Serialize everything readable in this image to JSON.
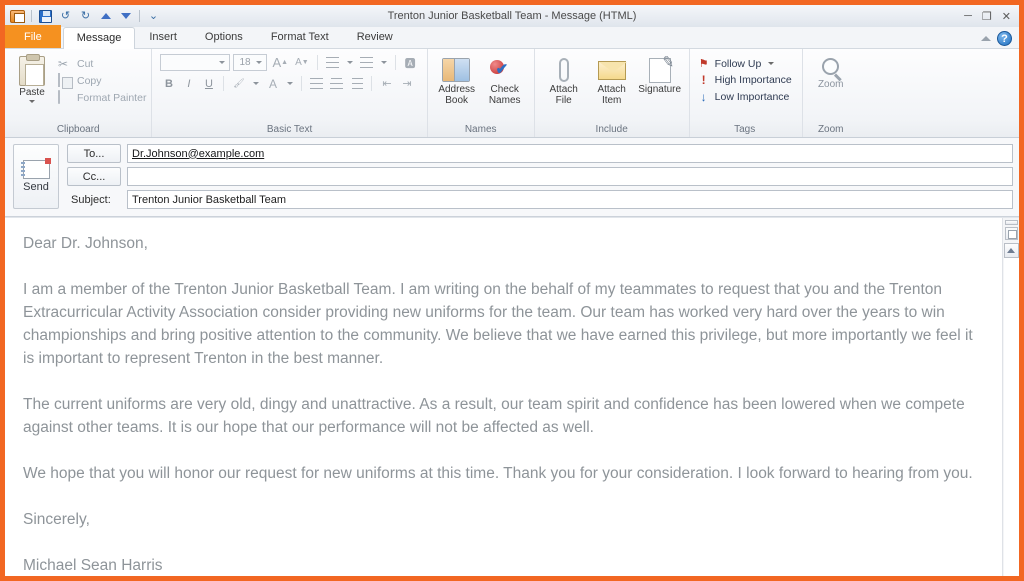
{
  "window": {
    "title": "Trenton Junior Basketball Team  -  Message (HTML)",
    "minimize": "─",
    "restore": "❐",
    "close": "✕",
    "accent_color": "#f26722",
    "file_tab_color": "#f59120"
  },
  "quick_access": {
    "items": [
      {
        "name": "outlook-icon",
        "label": "Outlook"
      },
      {
        "name": "save-icon",
        "label": "Save"
      },
      {
        "name": "undo-icon",
        "label": "Undo"
      },
      {
        "name": "redo-icon",
        "label": "Redo"
      },
      {
        "name": "previous-item-icon",
        "label": "Previous Item"
      },
      {
        "name": "next-item-icon",
        "label": "Next Item"
      },
      {
        "name": "customize-icon",
        "label": "Customize Quick Access Toolbar"
      }
    ],
    "undo_glyph": "↺",
    "redo_glyph": "↻",
    "customize_glyph": "⌄"
  },
  "tabs": [
    {
      "label": "File",
      "active": false
    },
    {
      "label": "Message",
      "active": true
    },
    {
      "label": "Insert",
      "active": false
    },
    {
      "label": "Options",
      "active": false
    },
    {
      "label": "Format Text",
      "active": false
    },
    {
      "label": "Review",
      "active": false
    }
  ],
  "tab_right": {
    "collapse_ribbon": "Minimize the Ribbon",
    "help": "?"
  },
  "ribbon": {
    "clipboard": {
      "group_label": "Clipboard",
      "paste_label": "Paste",
      "cut_label": "Cut",
      "copy_label": "Copy",
      "format_painter_label": "Format Painter",
      "cut_glyph": "✂",
      "dialog_launcher": "◪"
    },
    "basic_text": {
      "group_label": "Basic Text",
      "font_name": "",
      "font_size": "18",
      "grow_font": "A",
      "shrink_font": "A",
      "bold": "B",
      "italic": "I",
      "underline": "U",
      "highlight": "ab",
      "font_color": "A",
      "bullets": "≔",
      "numbering": "≕",
      "clear_formatting": "A",
      "align_left": "≡",
      "align_center": "≡",
      "align_right": "≡",
      "decrease_indent": "⇤",
      "increase_indent": "⇥",
      "dialog_launcher": "◪"
    },
    "names": {
      "group_label": "Names",
      "address_book_label": "Address Book",
      "check_names_label": "Check Names"
    },
    "include": {
      "group_label": "Include",
      "attach_file_label": "Attach File",
      "attach_item_label": "Attach Item",
      "signature_label": "Signature"
    },
    "tags": {
      "group_label": "Tags",
      "follow_up_label": "Follow Up",
      "high_importance_label": "High Importance",
      "low_importance_label": "Low Importance",
      "follow_up_glyph": "⚑",
      "high_glyph": "!",
      "low_glyph": "↓",
      "dialog_launcher": "◪"
    },
    "zoom": {
      "group_label": "Zoom",
      "button_label": "Zoom"
    }
  },
  "message": {
    "send_button": "Send",
    "to_button": "To...",
    "cc_button": "Cc...",
    "subject_label": "Subject:",
    "to_value": "Dr.Johnson@example.com",
    "cc_value": "",
    "subject_value": "Trenton Junior Basketball Team"
  },
  "body": {
    "salutation": "Dear Dr. Johnson,",
    "paragraph_1": "I am a member of the Trenton Junior Basketball Team.  I am writing on the behalf of my teammates to request that you and the Trenton Extracurricular Activity Association consider providing new uniforms for the team.  Our team has worked very hard over the years to win championships and bring positive attention to the community.  We believe that we have earned this privilege, but more importantly we feel it is important to represent Trenton in the best manner.",
    "paragraph_2": "The current uniforms are very old, dingy and unattractive.  As a result, our team spirit and confidence has been lowered when we compete against other teams.  It is our hope that our performance will not be affected as well.",
    "paragraph_3": "We hope that you will honor our request for new uniforms at this time.  Thank you for your consideration.  I look forward to hearing from you.",
    "closing": "Sincerely,",
    "signature_name": "Michael Sean Harris"
  },
  "scrollbar": {
    "split_handle": "split-bar",
    "scroll_up": "▲"
  }
}
